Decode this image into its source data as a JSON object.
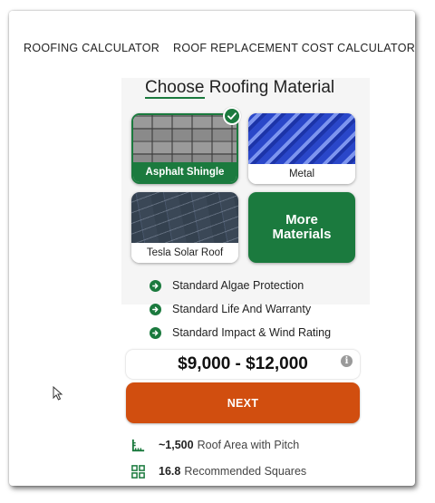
{
  "nav": {
    "items": [
      {
        "label": "ROOFING CALCULATOR"
      },
      {
        "label": "ROOF REPLACEMENT COST CALCULATOR"
      }
    ]
  },
  "title": {
    "part1": "Choose",
    "part2": " Roofing Material"
  },
  "materials": [
    {
      "label": "Asphalt Shingle",
      "selected": true,
      "icon": "asphalt-shingle-image"
    },
    {
      "label": "Metal",
      "selected": false,
      "icon": "metal-roof-image"
    },
    {
      "label": "Tesla Solar Roof",
      "selected": false,
      "icon": "tesla-solar-roof-image"
    }
  ],
  "more_materials": "More\nMaterials",
  "features": [
    {
      "label": "Standard Algae Protection",
      "icon": "arrow-circle-icon"
    },
    {
      "label": "Standard Life And Warranty",
      "icon": "arrow-circle-icon"
    },
    {
      "label": "Standard Impact & Wind Rating",
      "icon": "arrow-circle-icon"
    }
  ],
  "price": {
    "range": "$9,000 - $12,000",
    "info_icon": "i"
  },
  "next_button": "NEXT",
  "stats": [
    {
      "value": "~1,500",
      "label": "Roof Area with Pitch",
      "icon": "ruler-icon"
    },
    {
      "value": "16.8",
      "label": "Recommended Squares",
      "icon": "grid-icon"
    }
  ],
  "colors": {
    "accent_green": "#1b7a3e",
    "next_orange": "#d14e0f"
  }
}
